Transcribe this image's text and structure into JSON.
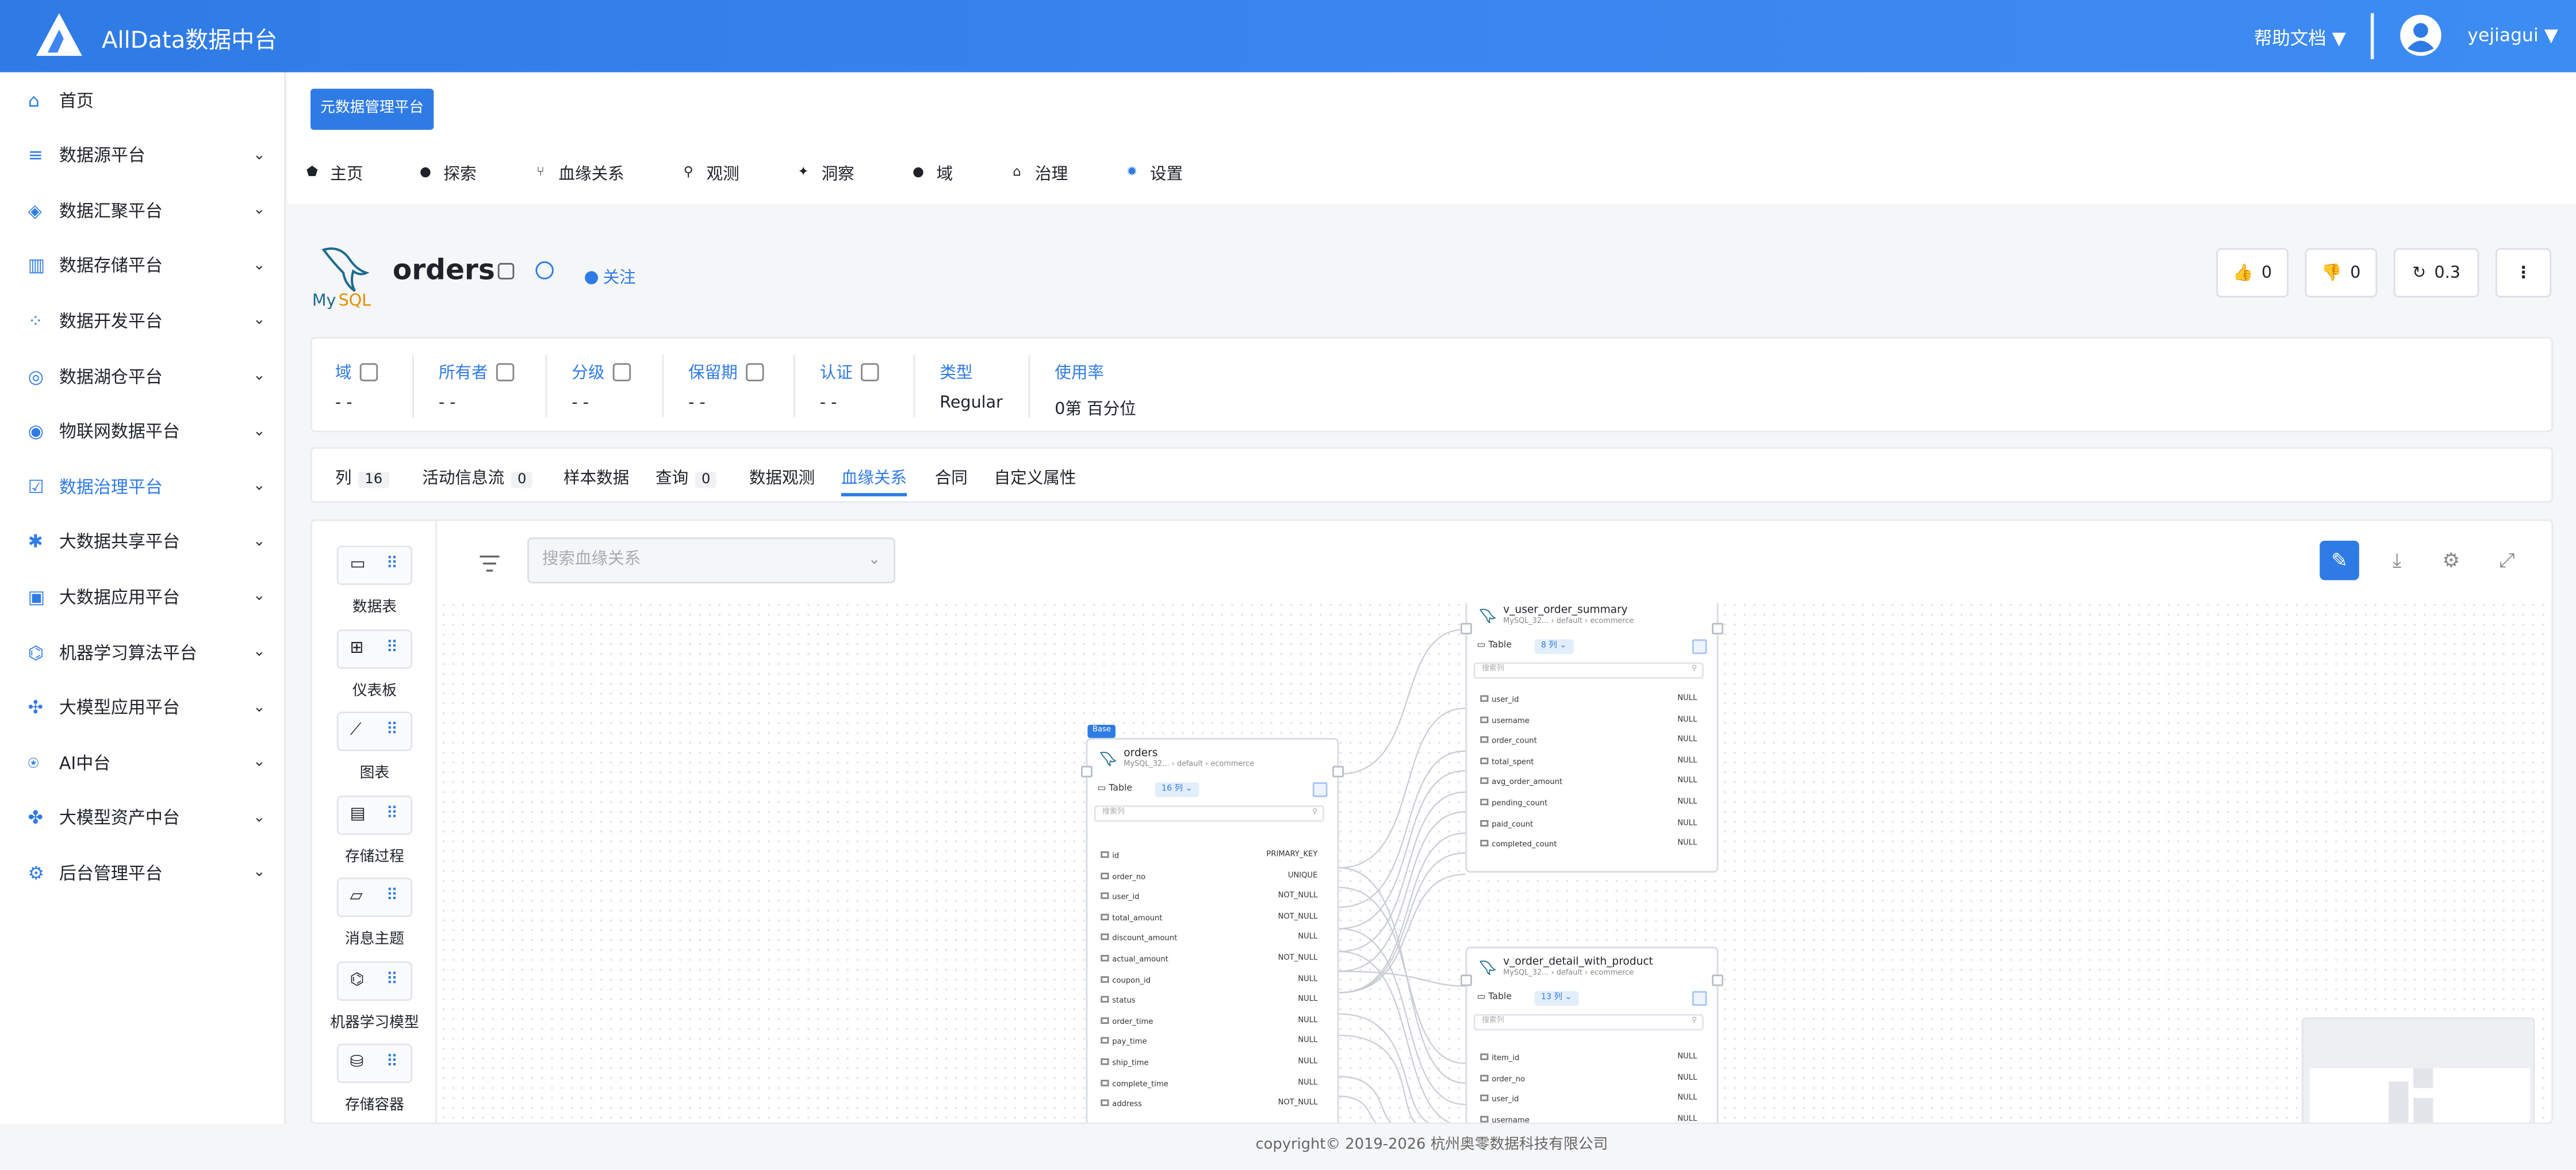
{
  "app": {
    "title": "AllData数据中台",
    "help": "帮助文档",
    "user": "yejiagui"
  },
  "sidebar": {
    "items": [
      {
        "label": "首页",
        "icon": "home-icon",
        "has_children": false
      },
      {
        "label": "数据源平台",
        "icon": "database-icon",
        "has_children": true
      },
      {
        "label": "数据汇聚平台",
        "icon": "stack-icon",
        "has_children": true
      },
      {
        "label": "数据存储平台",
        "icon": "bar-chart-icon",
        "has_children": true
      },
      {
        "label": "数据开发平台",
        "icon": "grid-icon",
        "has_children": true
      },
      {
        "label": "数据湖仓平台",
        "icon": "lake-icon",
        "has_children": true
      },
      {
        "label": "物联网数据平台",
        "icon": "iot-icon",
        "has_children": true
      },
      {
        "label": "数据治理平台",
        "icon": "governance-icon",
        "has_children": true,
        "active": true
      },
      {
        "label": "大数据共享平台",
        "icon": "share-icon",
        "has_children": true
      },
      {
        "label": "大数据应用平台",
        "icon": "app-icon",
        "has_children": true
      },
      {
        "label": "机器学习算法平台",
        "icon": "ml-icon",
        "has_children": true
      },
      {
        "label": "大模型应用平台",
        "icon": "llm-icon",
        "has_children": true
      },
      {
        "label": "AI中台",
        "icon": "ai-icon",
        "has_children": true
      },
      {
        "label": "大模型资产中台",
        "icon": "asset-icon",
        "has_children": true
      },
      {
        "label": "后台管理平台",
        "icon": "admin-icon",
        "has_children": true
      }
    ]
  },
  "header": {
    "meta_button": "元数据管理平台",
    "nav": [
      {
        "label": "主页",
        "icon": "home-icon"
      },
      {
        "label": "探索",
        "icon": "explore-icon"
      },
      {
        "label": "血缘关系",
        "icon": "lineage-icon"
      },
      {
        "label": "观测",
        "icon": "observe-icon"
      },
      {
        "label": "洞察",
        "icon": "insight-icon"
      },
      {
        "label": "域",
        "icon": "domain-icon"
      },
      {
        "label": "治理",
        "icon": "govern-icon"
      },
      {
        "label": "设置",
        "icon": "gear-icon"
      }
    ]
  },
  "entity": {
    "name": "orders",
    "follow": "关注",
    "votes_up": "0",
    "votes_down": "0",
    "version": "0.3"
  },
  "properties": [
    {
      "label": "域",
      "value": "- -",
      "editable": true
    },
    {
      "label": "所有者",
      "value": "- -",
      "editable": true
    },
    {
      "label": "分级",
      "value": "- -",
      "editable": true
    },
    {
      "label": "保留期",
      "value": "- -",
      "editable": true
    },
    {
      "label": "认证",
      "value": "- -",
      "editable": true
    },
    {
      "label": "类型",
      "value": "Regular",
      "editable": false
    },
    {
      "label": "使用率",
      "value": "0第 百分位",
      "editable": false
    }
  ],
  "tabs": [
    {
      "label": "列",
      "count": "16"
    },
    {
      "label": "活动信息流",
      "count": "0"
    },
    {
      "label": "样本数据",
      "count": null
    },
    {
      "label": "查询",
      "count": "0"
    },
    {
      "label": "数据观测",
      "count": null
    },
    {
      "label": "血缘关系",
      "count": null,
      "active": true
    },
    {
      "label": "合同",
      "count": null
    },
    {
      "label": "自定义属性",
      "count": null
    }
  ],
  "palette": [
    {
      "label": "数据表",
      "icon": "table-icon"
    },
    {
      "label": "仪表板",
      "icon": "dashboard-icon"
    },
    {
      "label": "图表",
      "icon": "line-chart-icon"
    },
    {
      "label": "存储过程",
      "icon": "procedure-icon"
    },
    {
      "label": "消息主题",
      "icon": "topic-icon"
    },
    {
      "label": "机器学习模型",
      "icon": "ml-model-icon"
    },
    {
      "label": "存储容器",
      "icon": "container-icon"
    }
  ],
  "lineage": {
    "search_placeholder": "搜索血缘关系",
    "nodes": {
      "orders": {
        "badge": "Base",
        "title": "orders",
        "source": "MySQL_32...",
        "path_db": "default",
        "path_schema": "ecommerce",
        "type": "Table",
        "cols": "16 列",
        "search": "搜索列",
        "columns": [
          {
            "name": "id",
            "constraint": "PRIMARY_KEY"
          },
          {
            "name": "order_no",
            "constraint": "UNIQUE"
          },
          {
            "name": "user_id",
            "constraint": "NOT_NULL"
          },
          {
            "name": "total_amount",
            "constraint": "NOT_NULL"
          },
          {
            "name": "discount_amount",
            "constraint": "NULL"
          },
          {
            "name": "actual_amount",
            "constraint": "NOT_NULL"
          },
          {
            "name": "coupon_id",
            "constraint": "NULL"
          },
          {
            "name": "status",
            "constraint": "NULL"
          },
          {
            "name": "order_time",
            "constraint": "NULL"
          },
          {
            "name": "pay_time",
            "constraint": "NULL"
          },
          {
            "name": "ship_time",
            "constraint": "NULL"
          },
          {
            "name": "complete_time",
            "constraint": "NULL"
          },
          {
            "name": "address",
            "constraint": "NOT_NULL"
          }
        ]
      },
      "summary": {
        "title": "v_user_order_summary",
        "source": "MySQL_32...",
        "path_db": "default",
        "path_schema": "ecommerce",
        "type": "Table",
        "cols": "8 列",
        "search": "搜索列",
        "columns": [
          {
            "name": "user_id",
            "constraint": "NULL"
          },
          {
            "name": "username",
            "constraint": "NULL"
          },
          {
            "name": "order_count",
            "constraint": "NULL"
          },
          {
            "name": "total_spent",
            "constraint": "NULL"
          },
          {
            "name": "avg_order_amount",
            "constraint": "NULL"
          },
          {
            "name": "pending_count",
            "constraint": "NULL"
          },
          {
            "name": "paid_count",
            "constraint": "NULL"
          },
          {
            "name": "completed_count",
            "constraint": "NULL"
          }
        ]
      },
      "detail": {
        "title": "v_order_detail_with_product",
        "source": "MySQL_32...",
        "path_db": "default",
        "path_schema": "ecommerce",
        "type": "Table",
        "cols": "13 列",
        "search": "搜索列",
        "columns": [
          {
            "name": "item_id",
            "constraint": "NULL"
          },
          {
            "name": "order_no",
            "constraint": "NULL"
          },
          {
            "name": "user_id",
            "constraint": "NULL"
          },
          {
            "name": "username",
            "constraint": "NULL"
          }
        ]
      }
    }
  },
  "footer": "copyright© 2019-2026 杭州奥零数据科技有限公司",
  "colors": {
    "primary": "#2f7be6",
    "topbar": "#3b86f0",
    "background": "#f5f6f8"
  }
}
